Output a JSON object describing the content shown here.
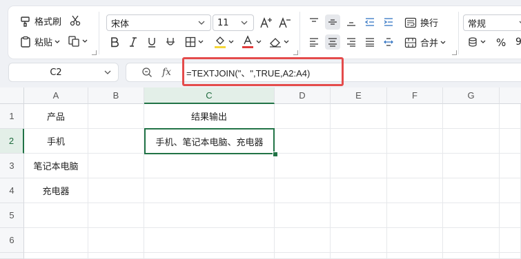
{
  "ribbon": {
    "format_painter": "格式刷",
    "paste": "粘贴",
    "font_name": "宋体",
    "font_size": "11",
    "wrap_text": "换行",
    "merge": "合并",
    "number_format": "常规",
    "percent": "%",
    "comma": "9"
  },
  "formula_bar": {
    "name_box": "C2",
    "fx": "fx",
    "formula": "=TEXTJOIN(\"、\",TRUE,A2:A4)"
  },
  "sheet": {
    "columns": [
      "A",
      "B",
      "C",
      "D",
      "E",
      "F",
      "G"
    ],
    "rows": [
      "1",
      "2",
      "3",
      "4",
      "5",
      "6"
    ],
    "cells": {
      "A1": "产品",
      "A2": "手机",
      "A3": "笔记本电脑",
      "A4": "充电器",
      "C1": "结果输出",
      "C2": "手机、笔记本电脑、充电器"
    }
  },
  "colors": {
    "accent": "#217346",
    "highlight": "#e44b4b",
    "font_color": "#e03b3b",
    "fill_color": "#f5d638"
  }
}
